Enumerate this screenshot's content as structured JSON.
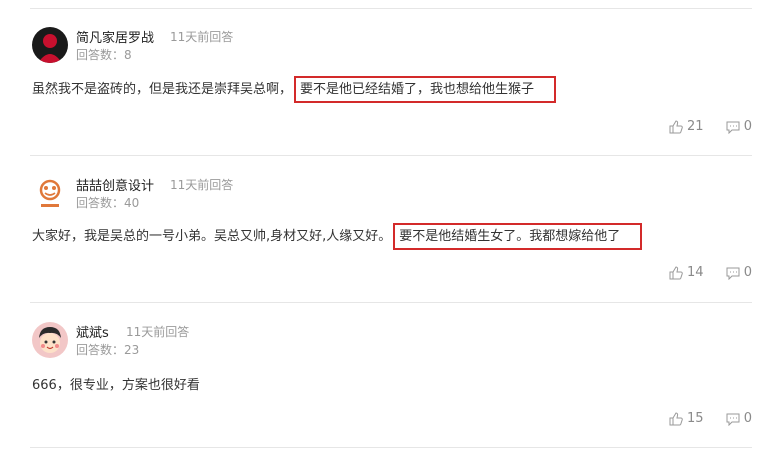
{
  "answers": [
    {
      "user": "简凡家居罗战",
      "time": "11天前回答",
      "count_label": "回答数：",
      "count": "8",
      "text_before": "虽然我不是盗砖的，但是我还是崇拜吴总啊，",
      "text_highlight": "要不是他已经结婚了，我也想给他生猴子",
      "likes": "21",
      "comments": "0"
    },
    {
      "user": "喆喆创意设计",
      "time": "11天前回答",
      "count_label": "回答数：",
      "count": "40",
      "text_before": "大家好，我是吴总的一号小弟。吴总又帅,身材又好,人缘又好。",
      "text_highlight": "要不是他结婚生女了。我都想嫁给他了",
      "likes": "14",
      "comments": "0"
    },
    {
      "user": "斌斌s",
      "time": "11天前回答",
      "count_label": "回答数：",
      "count": "23",
      "text_before": "666，很专业，方案也很好看",
      "text_highlight": "",
      "likes": "15",
      "comments": "0"
    }
  ],
  "icons": {
    "like": "thumbs-up-icon",
    "comment": "comment-icon"
  },
  "colors": {
    "highlight_border": "#d32a2a",
    "muted_text": "#9a9a9a"
  }
}
